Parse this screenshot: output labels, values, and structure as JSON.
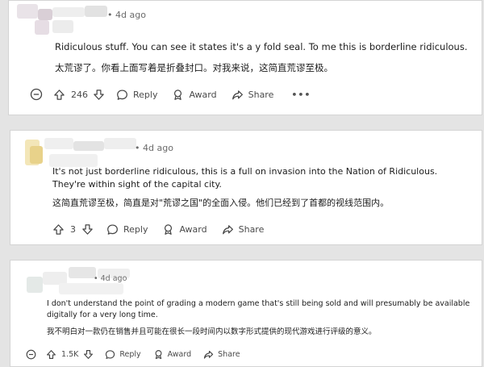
{
  "comments": [
    {
      "dot": "•",
      "time": "4d ago",
      "text_en": "Ridiculous stuff. You can see it states it's a y fold seal. To me this is borderline ridiculous.",
      "text_zh": "太荒谬了。你看上面写着是折叠封口。对我来说，这简直荒谬至极。",
      "votes": "246",
      "reply_label": "Reply",
      "award_label": "Award",
      "share_label": "Share",
      "more_label": "•••"
    },
    {
      "dot": "•",
      "time": "4d ago",
      "text_en": "It's not just borderline ridiculous, this is a full on invasion into the Nation of Ridiculous. They're within sight of the capital city.",
      "text_zh": "这简直荒谬至极，简直是对\"荒谬之国\"的全面入侵。他们已经到了首都的视线范围内。",
      "votes": "3",
      "reply_label": "Reply",
      "award_label": "Award",
      "share_label": "Share"
    },
    {
      "dot": "•",
      "time": "4d ago",
      "text_en": "I don't understand the point of grading a modern game that's still being sold and will presumably be available digitally for a very long time.",
      "text_zh": "我不明白对一款仍在销售并且可能在很长一段时间内以数字形式提供的现代游戏进行评级的意义。",
      "votes": "1.5K",
      "reply_label": "Reply",
      "award_label": "Award",
      "share_label": "Share"
    }
  ],
  "colors": {
    "background": "#e4e4e4",
    "card": "#ffffff",
    "muted": "#6b6b6b",
    "text": "#1c1c1c"
  },
  "icons": [
    "collapse-icon",
    "upvote-icon",
    "downvote-icon",
    "reply-icon",
    "award-icon",
    "share-icon",
    "more-icon"
  ]
}
